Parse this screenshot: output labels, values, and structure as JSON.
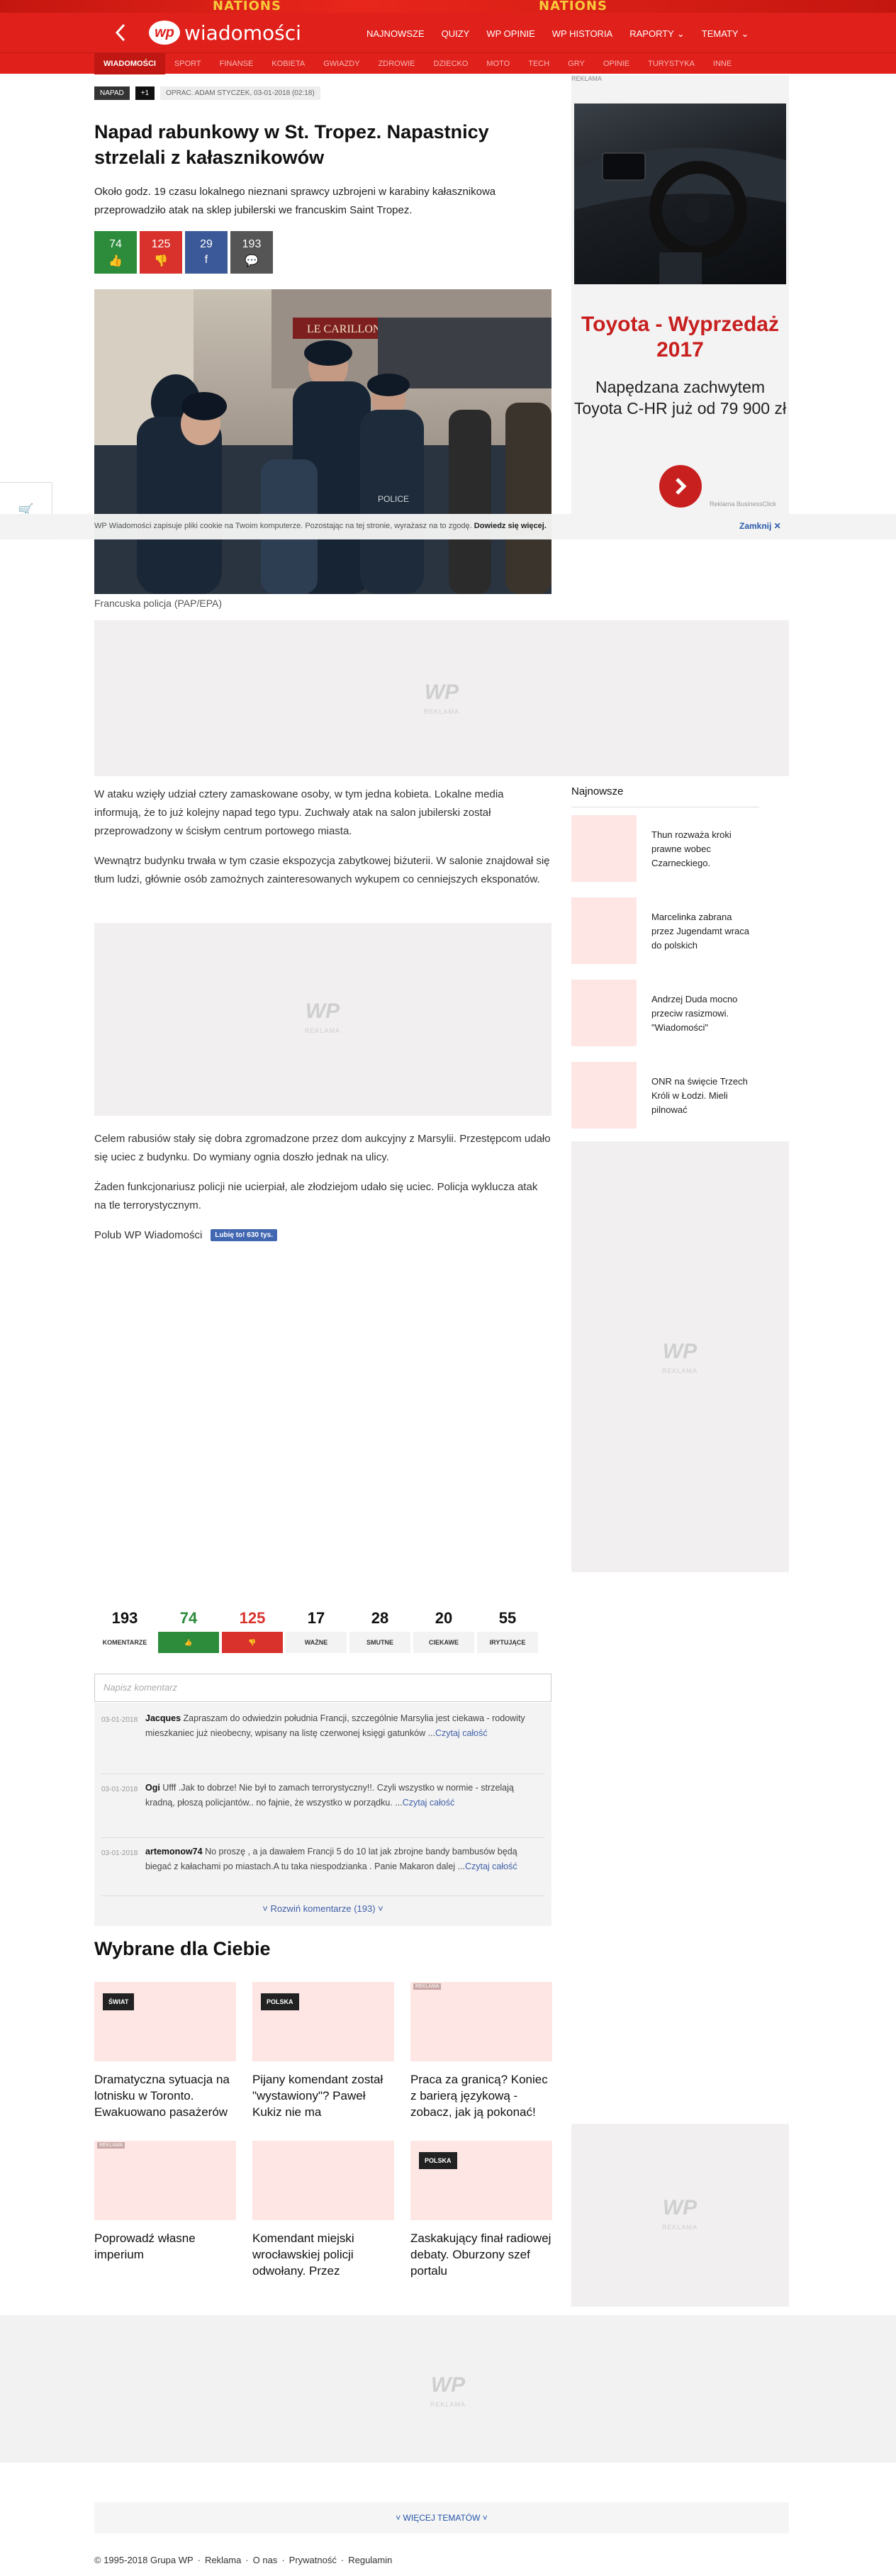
{
  "top_banner": {
    "text_left": "NATIONS",
    "text_right": "NATIONS"
  },
  "header": {
    "back_icon": "chevron-left-icon",
    "logo_mark": "wp",
    "logo_text": "wiadomości",
    "nav": [
      "NAJNOWSZE",
      "QUIZY",
      "WP OPINIE",
      "WP HISTORIA",
      "RAPORTY",
      "TEMATY"
    ],
    "chevron": "⌄"
  },
  "subnav": [
    "WIADOMOŚCI",
    "SPORT",
    "FINANSE",
    "KOBIETA",
    "GWIAZDY",
    "ZDROWIE",
    "DZIECKO",
    "MOTO",
    "TECH",
    "GRY",
    "OPINIE",
    "TURYSTYKA",
    "INNE"
  ],
  "article": {
    "tag": "NAPAD",
    "tag_plus": "+1",
    "byline": "OPRAC. ADAM STYCZEK, 03-01-2018 (02:18)",
    "title": "Napad rabunkowy w St. Tropez. Napastnicy strzelali z kałasznikowów",
    "lead": "Około godz. 19 czasu lokalnego nieznani sprawcy uzbrojeni w karabiny kałasznikowa przeprowadziło atak na sklep jubilerski we francuskim Saint Tropez.",
    "votes": [
      {
        "value": "74",
        "icon": "👍",
        "color": "#2c8c3c"
      },
      {
        "value": "125",
        "icon": "👎",
        "color": "#d9322c"
      },
      {
        "value": "29",
        "icon": "f",
        "color": "#3b5998"
      },
      {
        "value": "193",
        "icon": "💬",
        "color": "#555555"
      }
    ],
    "photo_sign": "LE CARILLON",
    "caption": "Francuska policja (PAP/EPA)",
    "p1": "W ataku wzięły udział cztery zamaskowane osoby, w tym jedna kobieta. Lokalne media informują, że to już kolejny napad tego typu. Zuchwały atak na salon jubilerski został przeprowadzony w ścisłym centrum portowego miasta.",
    "p2": "Wewnątrz budynku trwała w tym czasie ekspozycja zabytkowej biżuterii. W salonie znajdował się tłum ludzi, głównie osób zamożnych zainteresowanych wykupem co cenniejszych eksponatów.",
    "p3": "Celem rabusiów stały się dobra zgromadzone przez dom aukcyjny z Marsylii. Przestępcom udało się uciec z budynku. Do wymiany ognia doszło jednak na ulicy.",
    "p4": "Żaden funkcjonariusz policji nie ucierpiał, ale złodziejom udało się uciec. Policja wyklucza atak na tle terrorystycznym.",
    "like_text": "Polub WP Wiadomości",
    "fb_like": "Lubię to! 630 tys."
  },
  "cookie": {
    "text": "WP Wiadomości zapisuje pliki cookie na Twoim komputerze. Pozostając na tej stronie, wyrażasz na to zgodę.",
    "link": "Dowiedz się więcej.",
    "close": "Zamknij ✕"
  },
  "ads": {
    "label": "REKLAMA",
    "placeholder_mark": "WP",
    "placeholder_text": "REKLAMA",
    "toyota_title": "Toyota - Wyprzedaż 2017",
    "toyota_text": "Napędzana zachwytem Toyota C-HR już od 79 900 zł",
    "toyota_foot": "Reklama BusinessClick"
  },
  "latest": {
    "heading": "Najnowsze",
    "items": [
      "Thun rozważa kroki prawne wobec Czarneckiego.",
      "Marcelinka zabrana przez Jugendamt wraca do polskich",
      "Andrzej Duda mocno przeciw rasizmowi. \"Wiadomości\"",
      "ONR na święcie Trzech Króli w Łodzi. Mieli pilnować"
    ]
  },
  "comment_stats": [
    {
      "num": "193",
      "label": "KOMENTARZE",
      "color": "#111111"
    },
    {
      "num": "74",
      "label": "👍",
      "color": "#2c8c3c"
    },
    {
      "num": "125",
      "label": "👎",
      "color": "#d9322c"
    },
    {
      "num": "17",
      "label": "WAŻNE",
      "color": "#111111"
    },
    {
      "num": "28",
      "label": "SMUTNE",
      "color": "#111111"
    },
    {
      "num": "20",
      "label": "CIEKAWE",
      "color": "#111111"
    },
    {
      "num": "55",
      "label": "IRYTUJĄCE",
      "color": "#111111"
    }
  ],
  "comment_placeholder": "Napisz komentarz",
  "comments": [
    {
      "date": "03-01-2018",
      "author": "Jacques",
      "text": "Zapraszam do odwiedzin południa Francji, szczególnie Marsylia jest ciekawa - rodowity mieszkaniec już nieobecny, wpisany na listę czerwonej księgi gatunków ...",
      "more": "Czytaj całość"
    },
    {
      "date": "03-01-2018",
      "author": "Ogi",
      "text": "Ufff .Jak to dobrze! Nie był to zamach terrorystyczny!!. Czyli wszystko w normie - strzelają kradną, płoszą policjantów.. no fajnie, że wszystko w porządku. ...",
      "more": "Czytaj całość"
    },
    {
      "date": "03-01-2018",
      "author": "artemonow74",
      "text": "No proszę , a ja dawałem Francji 5 do 10 lat jak zbrojne bandy bambusów będą biegać z kałachami po miastach.A tu taka niespodzianka . Panie Makaron dalej ...",
      "more": "Czytaj całość"
    }
  ],
  "expand_comments": "˅ Rozwiń komentarze (193) ˅",
  "picked": {
    "heading": "Wybrane dla Ciebie",
    "cards": [
      {
        "label": "ŚWIAT",
        "title": "Dramatyczna sytuacja na lotnisku w Toronto. Ewakuowano pasażerów"
      },
      {
        "label": "POLSKA",
        "title": "Pijany komendant został \"wystawiony\"? Paweł Kukiz nie ma"
      },
      {
        "label": "REKLAMA",
        "title": "Praca za granicą? Koniec z barierą językową - zobacz, jak ją pokonać!"
      },
      {
        "label": "REKLAMA",
        "title": "Poprowadź własne imperium"
      },
      {
        "label": "",
        "title": "Komendant miejski wrocławskiej policji odwołany. Przez"
      },
      {
        "label": "POLSKA",
        "title": "Zaskakujący finał radiowej debaty. Oburzony szef portalu"
      }
    ]
  },
  "more_topics": "˅ WIĘCEJ TEMATÓW ˅",
  "footer": [
    "© 1995-2018 Grupa WP",
    "·",
    "Reklama",
    "·",
    "O nas",
    "·",
    "Prywatność",
    "·",
    "Regulamin"
  ]
}
